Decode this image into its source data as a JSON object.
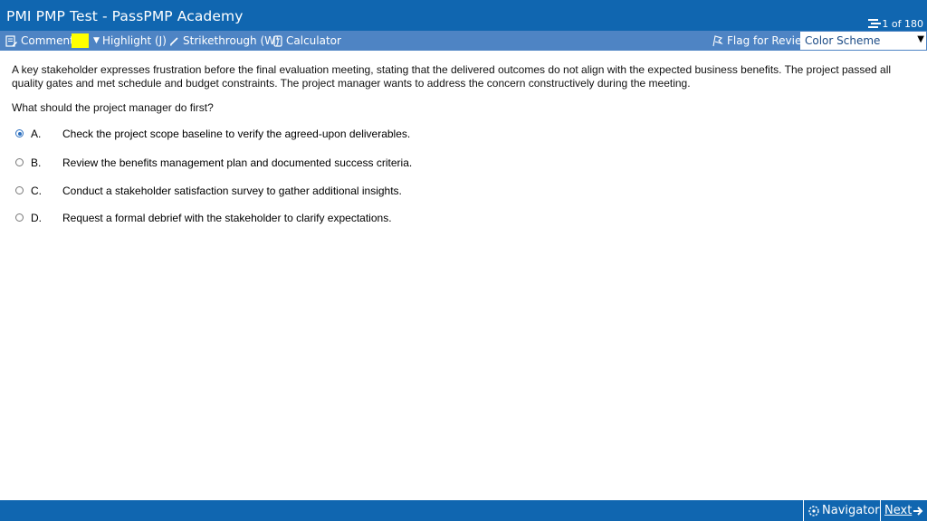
{
  "header": {
    "title": "PMI PMP Test - PassPMP Academy",
    "progress": "1 of 180"
  },
  "toolbar": {
    "comment_label": "Comment",
    "highlight_label": "Highlight (J)",
    "strikethrough_label": "Strikethrough (W)",
    "calculator_label": "Calculator",
    "flag_label": "Flag for Review",
    "color_scheme_label": "Color Scheme",
    "highlight_color": "#ffff00"
  },
  "question": {
    "stem": "A key stakeholder expresses frustration before the final evaluation meeting, stating that the delivered outcomes do not align with the expected business benefits. The project passed all quality gates and met schedule and budget constraints. The project manager wants to address the concern constructively during the meeting.",
    "prompt": "What should the project manager do first?",
    "selected": "A",
    "options": [
      {
        "letter": "A.",
        "text": "Check the project scope baseline to verify the agreed-upon deliverables."
      },
      {
        "letter": "B.",
        "text": "Review the benefits management plan and documented success criteria."
      },
      {
        "letter": "C.",
        "text": "Conduct a stakeholder satisfaction survey to gather additional insights."
      },
      {
        "letter": "D.",
        "text": "Request a formal debrief with the stakeholder to clarify expectations."
      }
    ]
  },
  "footer": {
    "navigator_label": "Navigator",
    "next_label": "Next"
  },
  "colors": {
    "header_blue": "#1066b0",
    "toolbar_blue": "#4e84c4"
  }
}
